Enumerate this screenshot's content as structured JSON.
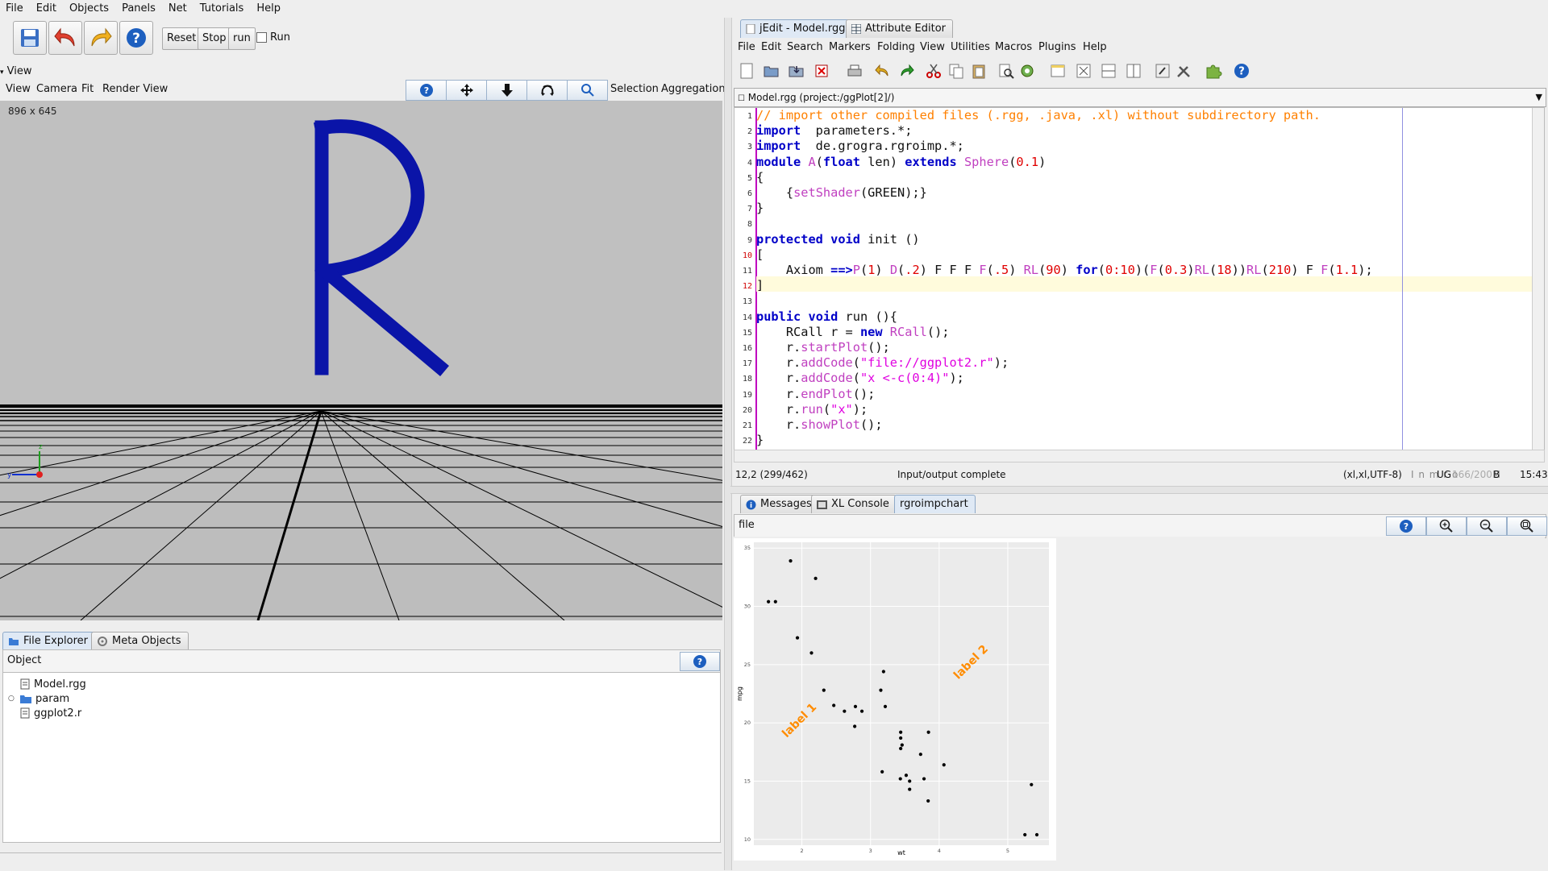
{
  "menubar": [
    "File",
    "Edit",
    "Objects",
    "Panels",
    "Net",
    "Tutorials",
    "Help"
  ],
  "toolbar": {
    "reset": "Reset",
    "stop": "Stop",
    "run": "run",
    "run_check": "Run"
  },
  "view": {
    "title": "View",
    "menu": [
      "View",
      "Camera",
      "Fit",
      "Render View"
    ],
    "right_menu": [
      "Selection",
      "Aggregation"
    ],
    "dims": "896 x 645"
  },
  "file_explorer": {
    "tabs": [
      "File Explorer",
      "Meta Objects"
    ],
    "column": "Object",
    "items": [
      "Model.rgg",
      "param",
      "ggplot2.r"
    ]
  },
  "editor": {
    "tabs": [
      "jEdit - Model.rgg",
      "Attribute Editor"
    ],
    "menu": [
      "File",
      "Edit",
      "Search",
      "Markers",
      "Folding",
      "View",
      "Utilities",
      "Macros",
      "Plugins",
      "Help"
    ],
    "path": "Model.rgg (project:/ggPlot[2]/)",
    "status_left": "12,2 (299/462)",
    "status_mid": "Input/output complete",
    "status_right": "(xl,xl,UTF-8)",
    "status_flags": "I n m r o",
    "status_ug": "UG",
    "status_mem": "166/200M",
    "status_b": "B",
    "status_time": "15:43"
  },
  "bottom_panel": {
    "tabs": [
      "Messages",
      "XL Console",
      "rgroimpchart"
    ],
    "label": "file"
  },
  "chart_data": {
    "type": "scatter",
    "xlabel": "wt",
    "ylabel": "mpg",
    "xticks": [
      2,
      3,
      4,
      5
    ],
    "yticks": [
      10,
      15,
      20,
      25,
      30,
      35
    ],
    "xlim": [
      1.3,
      5.6
    ],
    "ylim": [
      9.5,
      35.5
    ],
    "annotations": [
      {
        "text": "label 1",
        "x": 2.0,
        "y": 20.0,
        "angle": 45,
        "color": "#ff8c00"
      },
      {
        "text": "label 2",
        "x": 4.5,
        "y": 25.0,
        "angle": 45,
        "color": "#ff8c00"
      }
    ],
    "points": [
      [
        2.62,
        21.0
      ],
      [
        2.875,
        21.0
      ],
      [
        2.32,
        22.8
      ],
      [
        3.215,
        21.4
      ],
      [
        3.44,
        18.7
      ],
      [
        3.46,
        18.1
      ],
      [
        3.57,
        14.3
      ],
      [
        3.19,
        24.4
      ],
      [
        3.15,
        22.8
      ],
      [
        3.44,
        19.2
      ],
      [
        3.44,
        17.8
      ],
      [
        4.07,
        16.4
      ],
      [
        3.73,
        17.3
      ],
      [
        3.78,
        15.2
      ],
      [
        5.25,
        10.4
      ],
      [
        5.424,
        10.4
      ],
      [
        5.345,
        14.7
      ],
      [
        2.2,
        32.4
      ],
      [
        1.615,
        30.4
      ],
      [
        1.835,
        33.9
      ],
      [
        2.465,
        21.5
      ],
      [
        3.52,
        15.5
      ],
      [
        3.435,
        15.2
      ],
      [
        3.84,
        13.3
      ],
      [
        3.845,
        19.2
      ],
      [
        1.935,
        27.3
      ],
      [
        2.14,
        26.0
      ],
      [
        1.513,
        30.4
      ],
      [
        3.17,
        15.8
      ],
      [
        2.77,
        19.7
      ],
      [
        3.57,
        15.0
      ],
      [
        2.78,
        21.4
      ]
    ]
  }
}
